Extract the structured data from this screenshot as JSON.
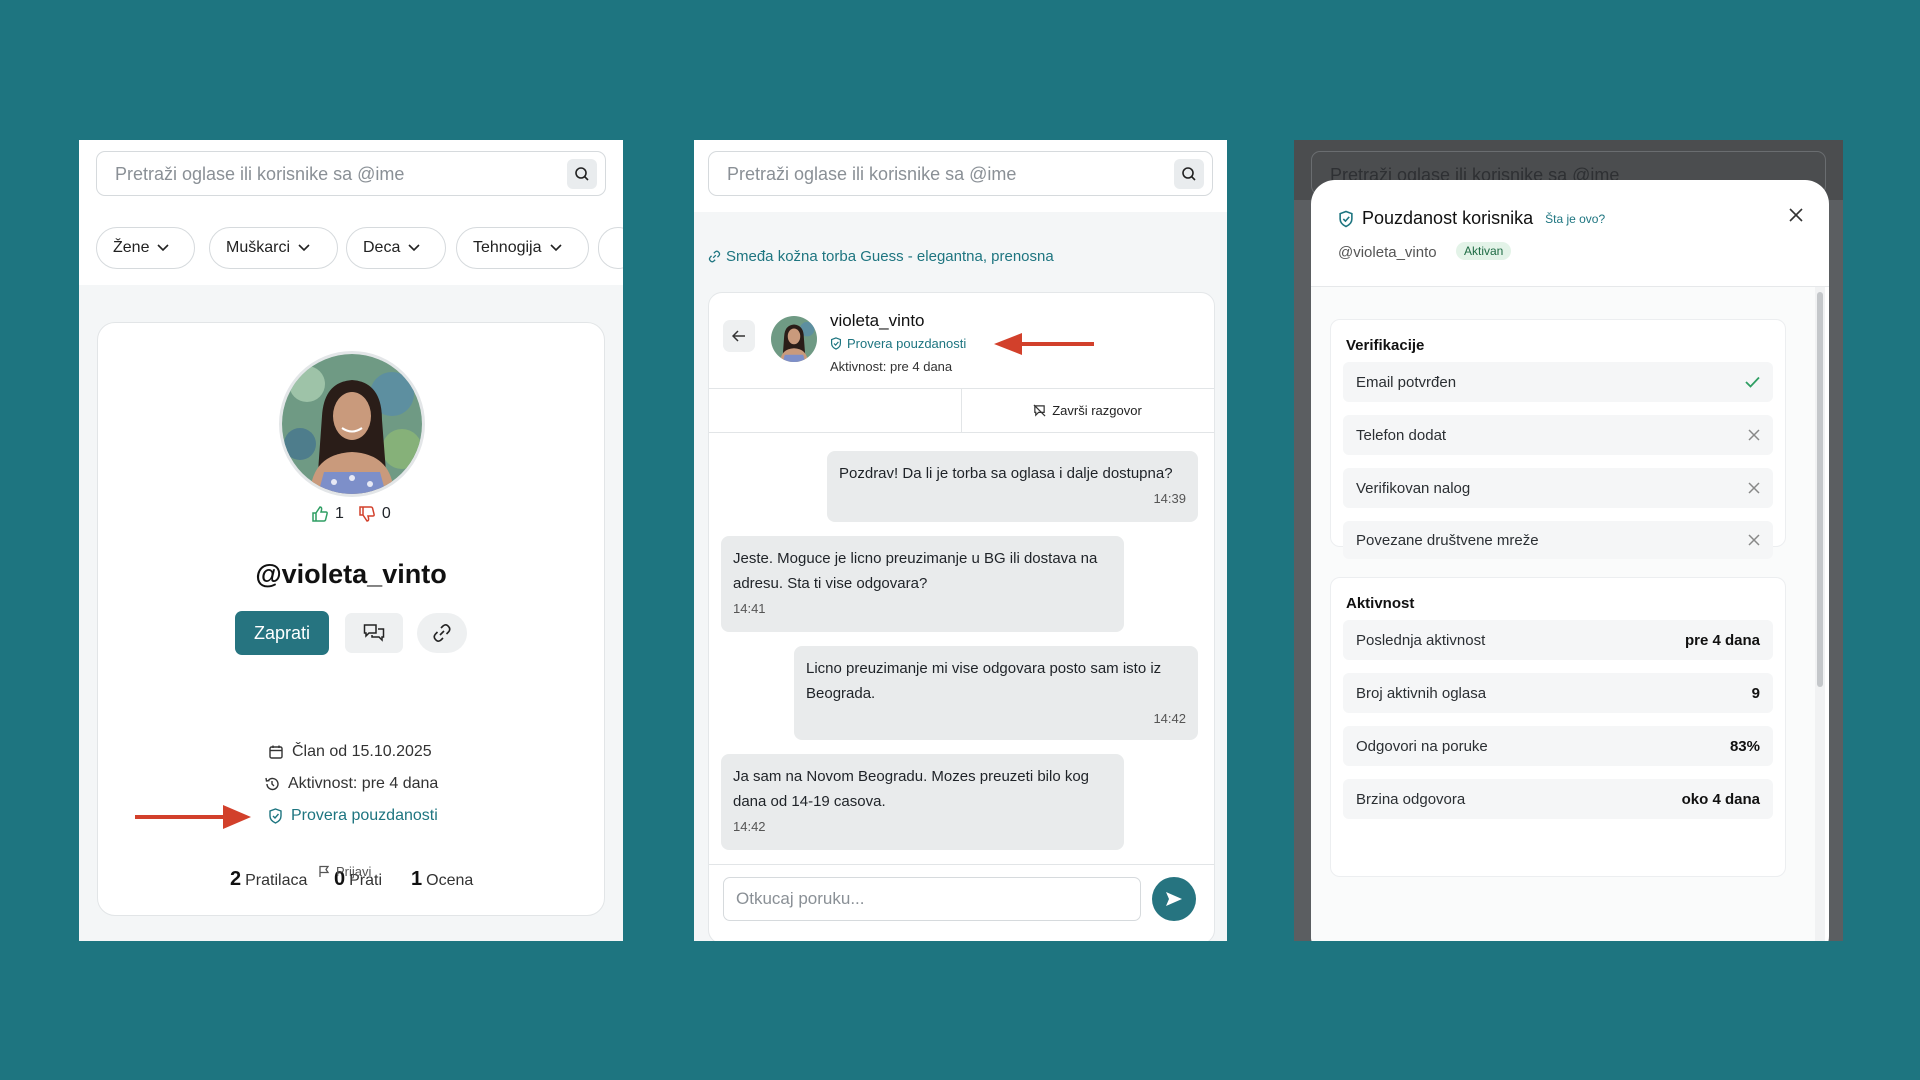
{
  "search": {
    "placeholder": "Pretraži oglase ili korisnike sa @ime"
  },
  "categories": [
    "Žene",
    "Muškarci",
    "Deca",
    "Tehnogija"
  ],
  "profile": {
    "username": "@violeta_vinto",
    "likes": "1",
    "dislikes": "0",
    "follow_label": "Zaprati",
    "followers_count": "2",
    "followers_label": "Pratilaca",
    "following_count": "0",
    "following_label": "Prati",
    "ratings_count": "1",
    "ratings_label": "Ocena",
    "member_since": "Član od 15.10.2025",
    "activity": "Aktivnost: pre 4 dana",
    "trust_link": "Provera pouzdanosti",
    "report": "Prijavi"
  },
  "chat": {
    "listing_link": "Smeđa kožna torba Guess - elegantna, prenosna",
    "contact_name": "violeta_vinto",
    "trust_link": "Provera pouzdanosti",
    "activity": "Aktivnost: pre 4 dana",
    "end_chat": "Završi razgovor",
    "messages": [
      {
        "text": "Pozdrav! Da li je torba sa oglasa i dalje dostupna?",
        "time": "14:39",
        "own": true
      },
      {
        "text": "Jeste. Moguce je licno preuzimanje u BG ili dostava na adresu. Sta ti vise odgovara?",
        "time": "14:41",
        "own": false
      },
      {
        "text": "Licno preuzimanje mi vise odgovara posto sam isto iz Beograda.",
        "time": "14:42",
        "own": true
      },
      {
        "text": "Ja sam na Novom Beogradu. Mozes preuzeti bilo kog dana od 14-19 casova.",
        "time": "14:42",
        "own": false
      }
    ],
    "input_placeholder": "Otkucaj poruku..."
  },
  "modal": {
    "background_search": "Pretraži oglase ili korisnike sa @ime",
    "title": "Pouzdanost korisnika",
    "whats_this": "Šta je ovo?",
    "username": "@violeta_vinto",
    "status_badge": "Aktivan",
    "verif_title": "Verifikacije",
    "verifications": [
      {
        "label": "Email potvrđen",
        "ok": true
      },
      {
        "label": "Telefon dodat",
        "ok": false
      },
      {
        "label": "Verifikovan nalog",
        "ok": false
      },
      {
        "label": "Povezane društvene mreže",
        "ok": false
      }
    ],
    "activity_title": "Aktivnost",
    "activity": [
      {
        "label": "Poslednja aktivnost",
        "value": "pre 4 dana"
      },
      {
        "label": "Broj aktivnih oglasa",
        "value": "9"
      },
      {
        "label": "Odgovori na poruke",
        "value": "83%"
      },
      {
        "label": "Brzina odgovora",
        "value": "oko 4 dana"
      }
    ]
  },
  "colors": {
    "background": "#1e7580",
    "accent": "#267480",
    "arrow": "#d2402b",
    "ok": "#2f9e63"
  }
}
